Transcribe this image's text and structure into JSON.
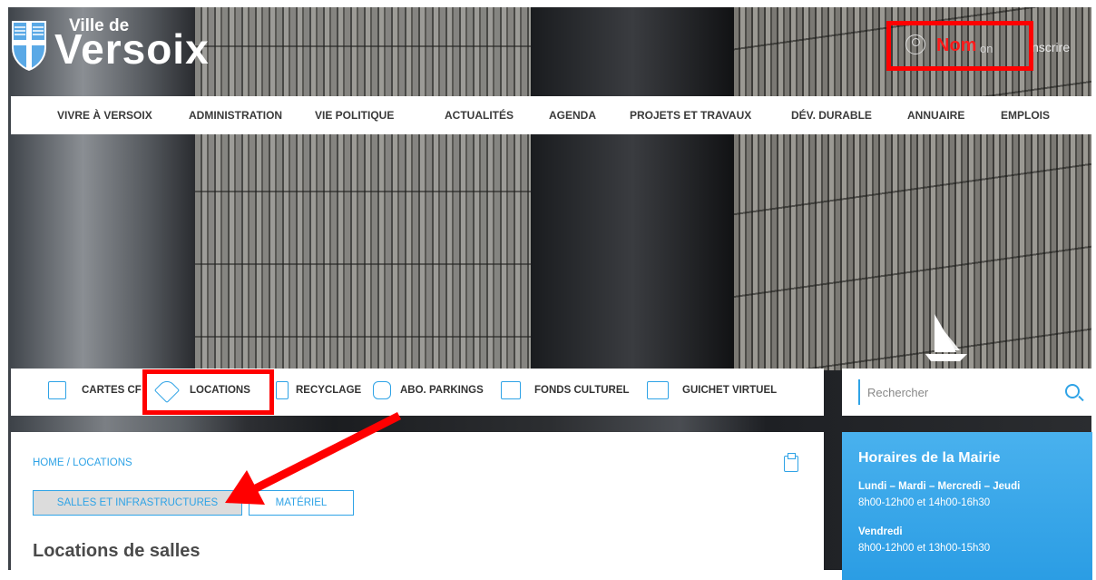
{
  "header": {
    "logo_small": "Ville de",
    "logo_big": "Versoix",
    "account": {
      "name_annotation": "Nom",
      "connect_fragment": "on",
      "register": "inscrire"
    }
  },
  "main_nav": {
    "items": [
      {
        "label": "VIVRE À VERSOIX"
      },
      {
        "label": "ADMINISTRATION"
      },
      {
        "label": "VIE POLITIQUE"
      },
      {
        "label": "ACTUALITÉS"
      },
      {
        "label": "AGENDA"
      },
      {
        "label": "PROJETS ET TRAVAUX"
      },
      {
        "label": "DÉV. DURABLE"
      },
      {
        "label": "ANNUAIRE"
      },
      {
        "label": "EMPLOIS"
      }
    ]
  },
  "quick_links": [
    {
      "label": "CARTES CF",
      "icon": "train-icon"
    },
    {
      "label": "LOCATIONS",
      "icon": "key-icon"
    },
    {
      "label": "RECYCLAGE",
      "icon": "bin-icon"
    },
    {
      "label": "ABO. PARKINGS",
      "icon": "car-icon"
    },
    {
      "label": "FONDS CULTUREL",
      "icon": "picture-icon"
    },
    {
      "label": "GUICHET VIRTUEL",
      "icon": "window-icon"
    }
  ],
  "search": {
    "placeholder": "Rechercher"
  },
  "content": {
    "breadcrumb": "HOME /  LOCATIONS",
    "tabs": [
      "SALLES ET INFRASTRUCTURES",
      "MATÉRIEL"
    ],
    "title": "Locations de salles"
  },
  "horaires": {
    "title": "Horaires de la Mairie",
    "days1": "Lundi – Mardi – Mercredi – Jeudi",
    "hours1": "8h00-12h00 et 14h00-16h30",
    "days2": "Vendredi",
    "hours2": "8h00-12h00 et 13h00-15h30"
  },
  "colors": {
    "accent": "#2fa3e6",
    "annotation": "#ff0000"
  }
}
